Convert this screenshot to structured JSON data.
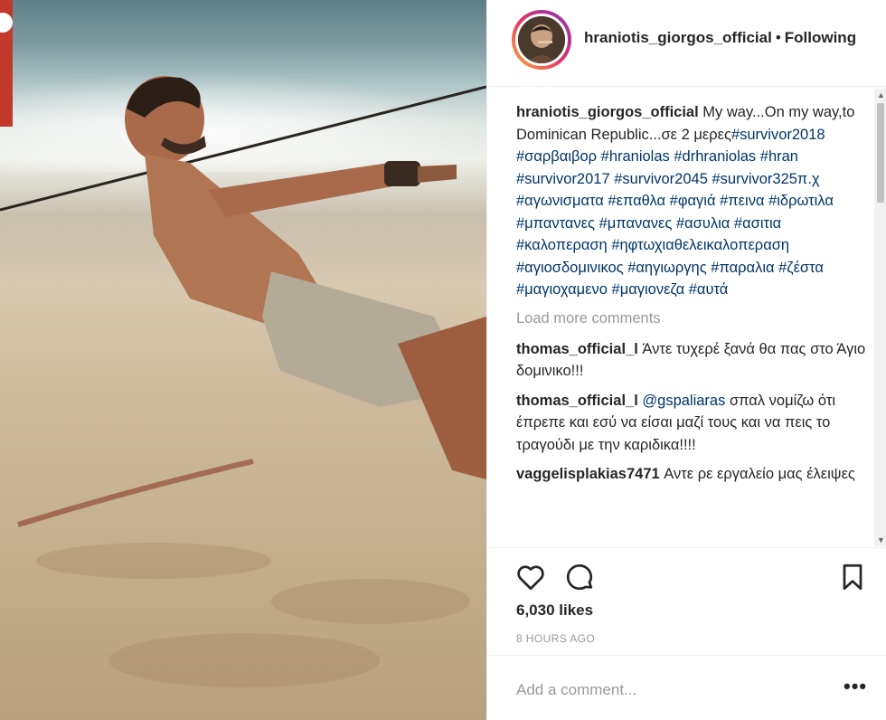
{
  "post": {
    "username": "hraniotis_giorgos_official",
    "separator": "•",
    "follow_status": "Following",
    "caption_user": "hraniotis_giorgos_official",
    "caption_text": "My way...On my way,to Dominican Republic...σε 2 μερες",
    "hashtags": [
      "#survivor2018",
      "#σαρβαιβορ",
      "#hraniolas",
      "#drhraniolas",
      "#hran",
      "#survivor2017",
      "#survivor2045",
      "#survivor325π.χ",
      "#αγωνισματα",
      "#επαθλα",
      "#φαγιά",
      "#πεινα",
      "#ιδρωτιλα",
      "#μπαντανες",
      "#μπανανες",
      "#ασυλια",
      "#ασιτια",
      "#καλοπεραση",
      "#ηφτωχιαθελεικαλοπεραση",
      "#αγιοσδομινικος",
      "#αηγιωργης",
      "#παραλια",
      "#ζέστα",
      "#μαγιοχαμενο",
      "#μαγιονεζα",
      "#αυτά"
    ],
    "load_more": "Load more comments",
    "comments": [
      {
        "user": "thomas_official_l",
        "mention": "",
        "text": "Άντε τυχερέ ξανά θα πας στο Άγιο δομινικο!!!"
      },
      {
        "user": "thomas_official_l",
        "mention": "@gspaliaras",
        "text": "σπαλ νομίζω ότι έπρεπε και εσύ να είσαι μαζί τους και να πεις το τραγούδι με την καριδικα!!!!"
      },
      {
        "user": "vaggelisplakias7471",
        "mention": "",
        "text": "Αντε ρε εργαλείο μας έλειψες"
      }
    ],
    "likes": "6,030 likes",
    "timestamp": "8 HOURS AGO",
    "comment_placeholder": "Add a comment...",
    "more_label": "•••"
  },
  "icons": {
    "like": "heart-outline-icon",
    "comment": "speech-bubble-icon",
    "save": "bookmark-icon",
    "more": "ellipsis-icon"
  },
  "colors": {
    "text": "#262626",
    "hashtag": "#003569",
    "muted": "#999999",
    "border": "#efefef",
    "flag": "#c0392b"
  }
}
